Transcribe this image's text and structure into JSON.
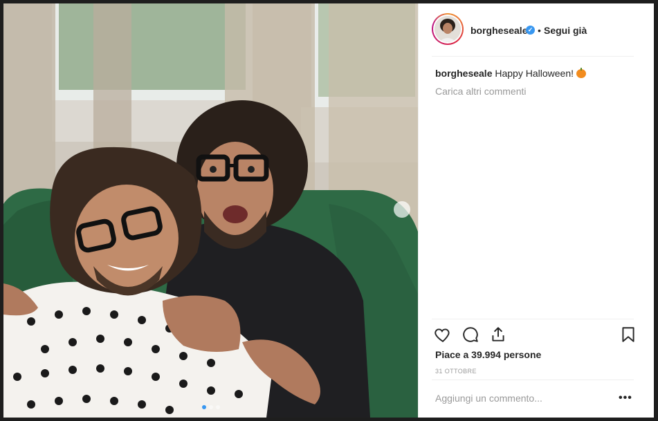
{
  "post": {
    "username": "borgheseale",
    "follow_status": "Segui già",
    "separator": "•",
    "verified_glyph": "✓",
    "caption_text": "Happy Halloween!",
    "caption_emoji": "pumpkin-emoji",
    "load_more_label": "Carica altri commenti",
    "likes_label": "Piace a 39.994 persone",
    "date_label": "31 OTTOBRE",
    "comment_placeholder": "Aggiungi un commento...",
    "more_options_label": "•••"
  },
  "icons": {
    "like": "heart-icon",
    "comment": "comment-bubble-icon",
    "share": "share-icon",
    "save": "bookmark-icon"
  },
  "photo": {
    "carousel_total": 3,
    "carousel_active": 1
  },
  "colors": {
    "accent": "#3897f0",
    "text": "#262626",
    "muted": "#999999",
    "divider": "#efefef"
  }
}
